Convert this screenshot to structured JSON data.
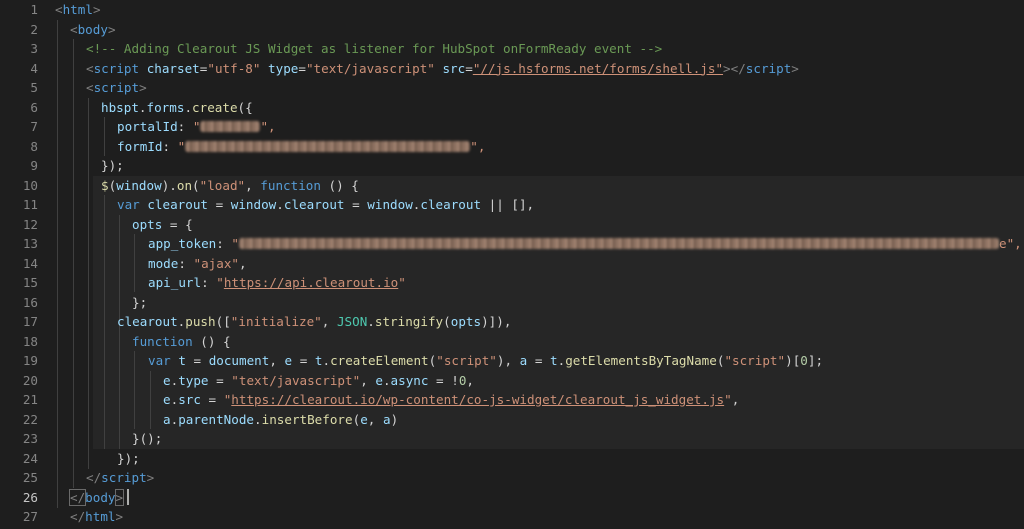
{
  "editor": {
    "line_numbers": [
      "1",
      "2",
      "3",
      "4",
      "5",
      "6",
      "7",
      "8",
      "9",
      "10",
      "11",
      "12",
      "13",
      "14",
      "15",
      "16",
      "17",
      "18",
      "19",
      "20",
      "21",
      "22",
      "23",
      "24",
      "25",
      "26",
      "27"
    ],
    "active_line": "26",
    "lines": {
      "l1": {
        "t1": "<",
        "t2": "html",
        "t3": ">"
      },
      "l2": {
        "t1": "<",
        "t2": "body",
        "t3": ">"
      },
      "l3": {
        "t1": "<!-- Adding Clearout JS Widget as listener for HubSpot onFormReady event -->"
      },
      "l4": {
        "t1": "<",
        "t2": "script",
        "t3": "charset",
        "t4": "=",
        "t5": "\"utf-8\"",
        "t6": "type",
        "t7": "=",
        "t8": "\"text/javascript\"",
        "t9": "src",
        "t10": "=",
        "t11": "\"//js.hsforms.net/forms/shell.js\"",
        "t12": "></",
        "t13": "script",
        "t14": ">"
      },
      "l5": {
        "t1": "<",
        "t2": "script",
        "t3": ">"
      },
      "l6": {
        "t1": "hbspt",
        "t2": ".",
        "t3": "forms",
        "t4": ".",
        "t5": "create",
        "t6": "({"
      },
      "l7": {
        "t1": "portalId",
        "t2": ": ",
        "t3": "\"",
        "t4": "\","
      },
      "l8": {
        "t1": "formId",
        "t2": ": ",
        "t3": "\"",
        "t4": "\","
      },
      "l9": {
        "t1": "});"
      },
      "l10": {
        "t1": "$",
        "t2": "(",
        "t3": "window",
        "t4": ").",
        "t5": "on",
        "t6": "(",
        "t7": "\"load\"",
        "t8": ", ",
        "t9": "function",
        "t10": " () {"
      },
      "l11": {
        "t1": "var",
        "t2": "clearout",
        "t3": " = ",
        "t4": "window",
        "t5": ".",
        "t6": "clearout",
        "t7": " = ",
        "t8": "window",
        "t9": ".",
        "t10": "clearout",
        "t11": " || [],"
      },
      "l12": {
        "t1": "opts",
        "t2": " = {"
      },
      "l13": {
        "t1": "app_token",
        "t2": ": ",
        "t3": "\"",
        "t4": "e\","
      },
      "l14": {
        "t1": "mode",
        "t2": ": ",
        "t3": "\"ajax\"",
        "t4": ","
      },
      "l15": {
        "t1": "api_url",
        "t2": ": ",
        "t3": "\"",
        "t4": "https://api.clearout.io",
        "t5": "\""
      },
      "l16": {
        "t1": "};"
      },
      "l17": {
        "t1": "clearout",
        "t2": ".",
        "t3": "push",
        "t4": "([",
        "t5": "\"initialize\"",
        "t6": ", ",
        "t7": "JSON",
        "t8": ".",
        "t9": "stringify",
        "t10": "(",
        "t11": "opts",
        "t12": ")]),"
      },
      "l18": {
        "t1": "function",
        "t2": " () {"
      },
      "l19": {
        "t1": "var",
        "t2": "t",
        "t3": " = ",
        "t4": "document",
        "t5": ", ",
        "t6": "e",
        "t7": " = ",
        "t8": "t",
        "t9": ".",
        "t10": "createElement",
        "t11": "(",
        "t12": "\"script\"",
        "t13": "), ",
        "t14": "a",
        "t15": " = ",
        "t16": "t",
        "t17": ".",
        "t18": "getElementsByTagName",
        "t19": "(",
        "t20": "\"script\"",
        "t21": ")[",
        "t22": "0",
        "t23": "];"
      },
      "l20": {
        "t1": "e",
        "t2": ".",
        "t3": "type",
        "t4": " = ",
        "t5": "\"text/javascript\"",
        "t6": ", ",
        "t7": "e",
        "t8": ".",
        "t9": "async",
        "t10": " = !",
        "t11": "0",
        "t12": ","
      },
      "l21": {
        "t1": "e",
        "t2": ".",
        "t3": "src",
        "t4": " = ",
        "t5": "\"",
        "t6": "https://clearout.io/wp-content/co-js-widget/clearout_js_widget.js",
        "t7": "\"",
        "t8": ","
      },
      "l22": {
        "t1": "a",
        "t2": ".",
        "t3": "parentNode",
        "t4": ".",
        "t5": "insertBefore",
        "t6": "(",
        "t7": "e",
        "t8": ", ",
        "t9": "a",
        "t10": ")"
      },
      "l23": {
        "t1": "}();"
      },
      "l24": {
        "t1": "});"
      },
      "l25": {
        "t1": "</",
        "t2": "script",
        "t3": ">"
      },
      "l26": {
        "t1": "</",
        "t2": "body",
        "t3": ">"
      },
      "l27": {
        "t1": "</",
        "t2": "html",
        "t3": ">"
      }
    }
  },
  "colors": {
    "background": "#1e1e1e",
    "tag": "#569cd6",
    "string": "#ce9178",
    "comment": "#6a9955",
    "function": "#dcdcaa",
    "variable": "#9cdcfe"
  }
}
